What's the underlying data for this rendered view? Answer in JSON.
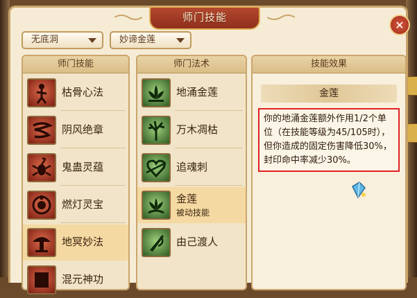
{
  "window": {
    "title": "师门技能",
    "close_glyph": "✕"
  },
  "filters": {
    "school": {
      "value": "无底洞"
    },
    "skill": {
      "value": "妙谛金莲"
    }
  },
  "panels": {
    "school_skills": {
      "header": "师门技能",
      "items": [
        {
          "label": "枯骨心法",
          "icon": "skeleton-figure-icon"
        },
        {
          "label": "阴风绝章",
          "icon": "wind-cloud-icon"
        },
        {
          "label": "鬼蛊灵蕴",
          "icon": "scorpion-icon"
        },
        {
          "label": "燃灯灵宝",
          "icon": "lamp-coin-icon"
        },
        {
          "label": "地冥妙法",
          "icon": "mushroom-cloud-icon",
          "selected": true
        },
        {
          "label": "混元神功",
          "icon": "scroll-icon"
        }
      ]
    },
    "school_spells": {
      "header": "师门法术",
      "items": [
        {
          "label": "地涌金莲",
          "icon": "lotus-icon"
        },
        {
          "label": "万木凋枯",
          "icon": "withered-tree-icon"
        },
        {
          "label": "追魂刺",
          "icon": "heart-arrow-icon"
        },
        {
          "label": "金莲",
          "sub": "被动技能",
          "icon": "golden-lotus-icon",
          "selected": true
        },
        {
          "label": "由己渡人",
          "icon": "fan-blade-icon"
        }
      ]
    },
    "skill_effect": {
      "header": "技能效果",
      "name": "金莲",
      "description": "你的地涌金莲额外作用1/2个单位（在技能等级为45/105时），但你造成的固定伤害降低30%，封印命中率减少30%。"
    }
  },
  "colors": {
    "title_plate": "#a33a22",
    "panel_bg": "#f1e4c8",
    "highlight_border": "#e02020",
    "selected_row": "#f5d9a2"
  }
}
